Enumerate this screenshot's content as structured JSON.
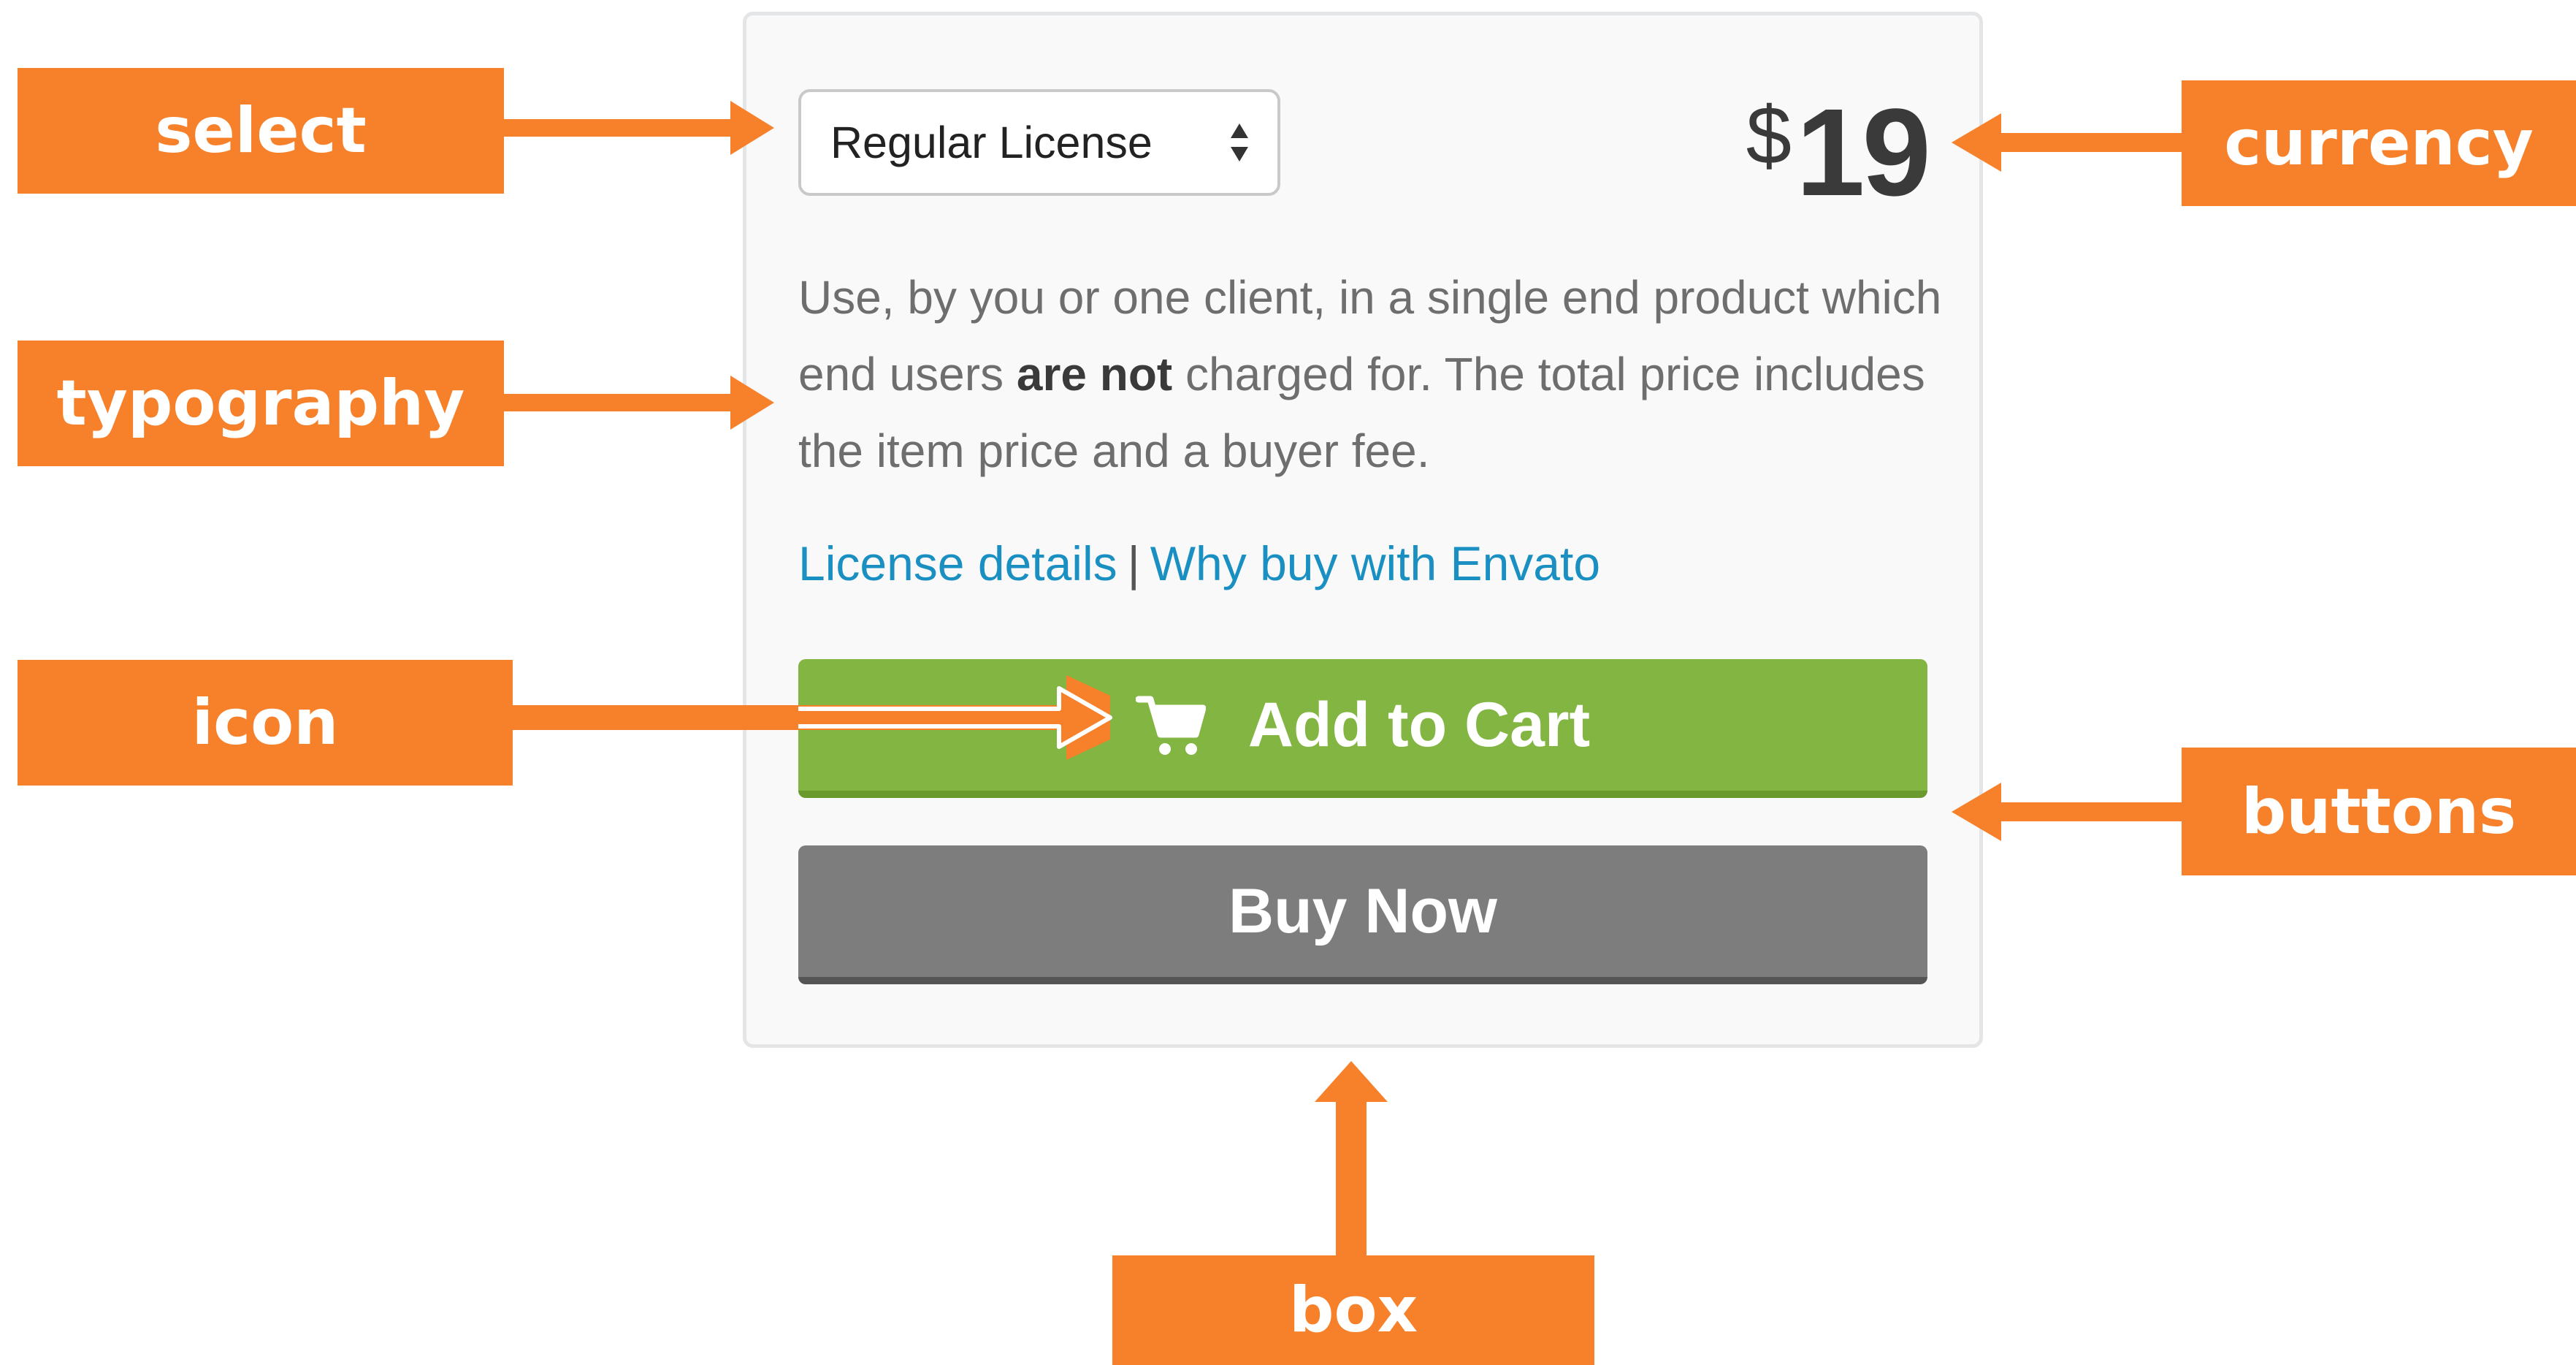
{
  "product": {
    "license_select": {
      "selected": "Regular License"
    },
    "price": {
      "currency": "$",
      "amount": "19"
    },
    "description": {
      "before": "Use, by you or one client, in a single end product which end users ",
      "emphasis": "are not",
      "after": " charged for. The total price includes the item price and a buyer fee."
    },
    "links": {
      "license_details": "License details",
      "separator": "|",
      "why_buy": "Why buy with Envato"
    },
    "buttons": {
      "add_to_cart": "Add to Cart",
      "buy_now": "Buy Now"
    }
  },
  "annotations": {
    "select": "select",
    "typography": "typography",
    "icon": "icon",
    "currency": "currency",
    "buttons": "buttons",
    "box": "box"
  },
  "colors": {
    "annotation": "#f7812b",
    "add_to_cart": "#82b541",
    "buy_now": "#7d7d7d",
    "link": "#1a8fc2"
  },
  "icons": {
    "select_arrows": "up-down-chevrons-icon",
    "cart": "shopping-cart-icon"
  }
}
